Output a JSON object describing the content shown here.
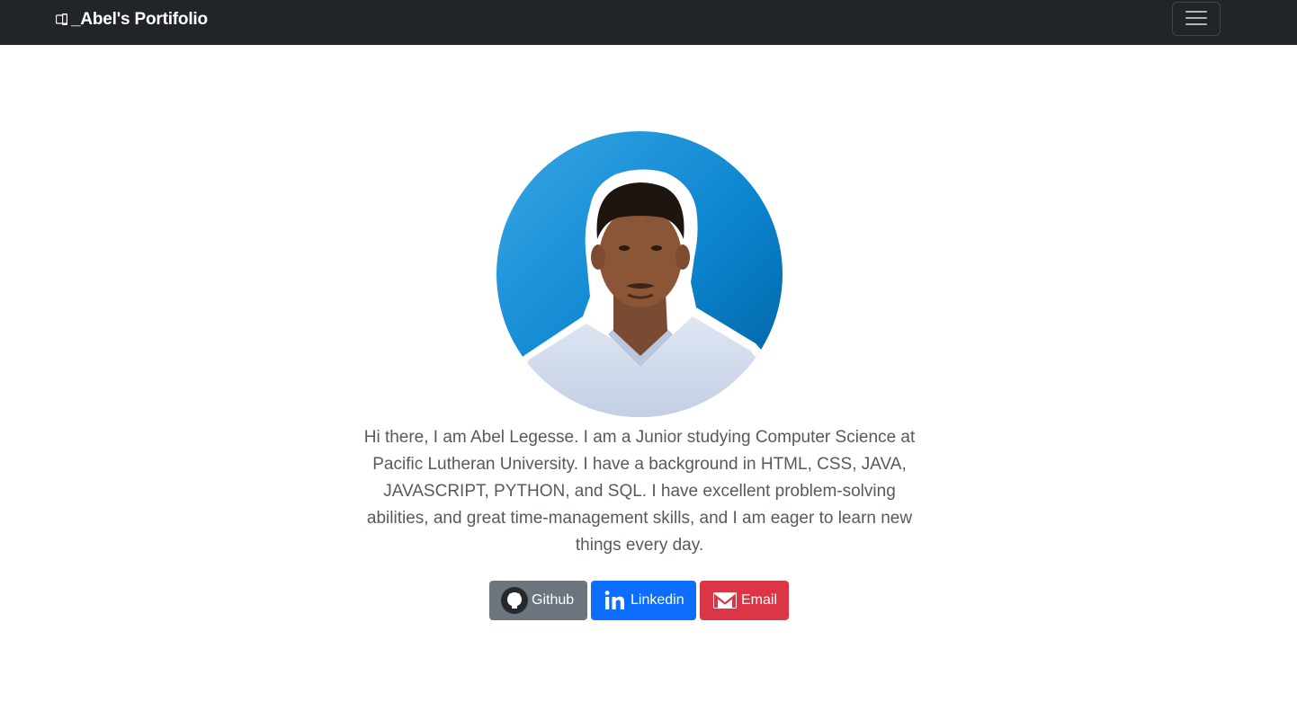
{
  "navbar": {
    "brand_label": "_Abel's Portifolio",
    "brand_icon": "mobile-device-icon",
    "toggler_icon": "hamburger-menu-icon"
  },
  "profile": {
    "image": "profile-photo"
  },
  "bio": {
    "text": "Hi there, I am Abel Legesse. I am a Junior studying Computer Science at Pacific Lutheran University. I have a background in HTML, CSS, JAVA, JAVASCRIPT, PYTHON, and SQL. I have excellent problem-solving abilities, and great time-management skills, and I am eager to learn new things every day."
  },
  "links": [
    {
      "label": "Github",
      "icon": "github-icon",
      "color": "#6c757d"
    },
    {
      "label": "Linkedin",
      "icon": "linkedin-icon",
      "color": "#0d6efd"
    },
    {
      "label": "Email",
      "icon": "gmail-icon",
      "color": "#dc3545"
    }
  ],
  "colors": {
    "navbar_bg": "#212529",
    "text": "#555a60"
  }
}
